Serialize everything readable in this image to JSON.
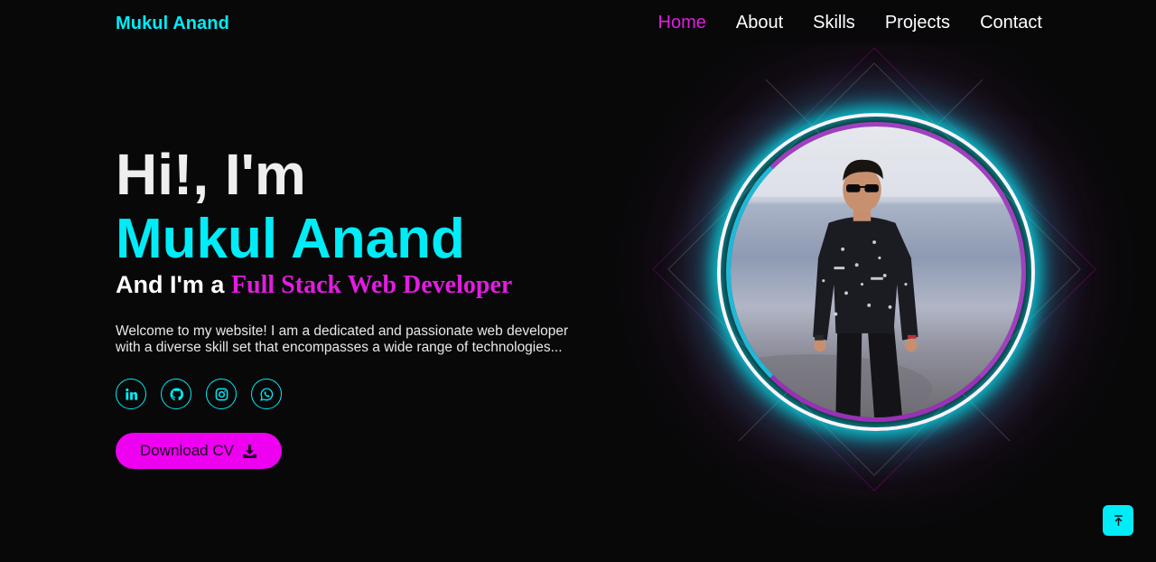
{
  "header": {
    "logo": "Mukul Anand",
    "nav": [
      {
        "label": "Home",
        "active": true
      },
      {
        "label": "About",
        "active": false
      },
      {
        "label": "Skills",
        "active": false
      },
      {
        "label": "Projects",
        "active": false
      },
      {
        "label": "Contact",
        "active": false
      }
    ]
  },
  "hero": {
    "greeting": "Hi!, I'm",
    "name": "Mukul Anand",
    "role_prefix": "And I'm a ",
    "role": "Full Stack Web Developer",
    "intro_line1": "Welcome to my website! I am a dedicated and passionate web developer",
    "intro_line2": "with a diverse skill set that encompasses a wide range of technologies...",
    "socials": [
      "linkedin-icon",
      "github-icon",
      "instagram-icon",
      "whatsapp-icon"
    ],
    "download_label": "Download CV"
  },
  "colors": {
    "background": "#080809",
    "accent_cyan": "#00ecf7",
    "accent_magenta": "#e21ddf",
    "button_magenta": "#ee00f0"
  },
  "icons": {
    "download": "download-icon",
    "scroll_top": "arrow-up-icon"
  }
}
